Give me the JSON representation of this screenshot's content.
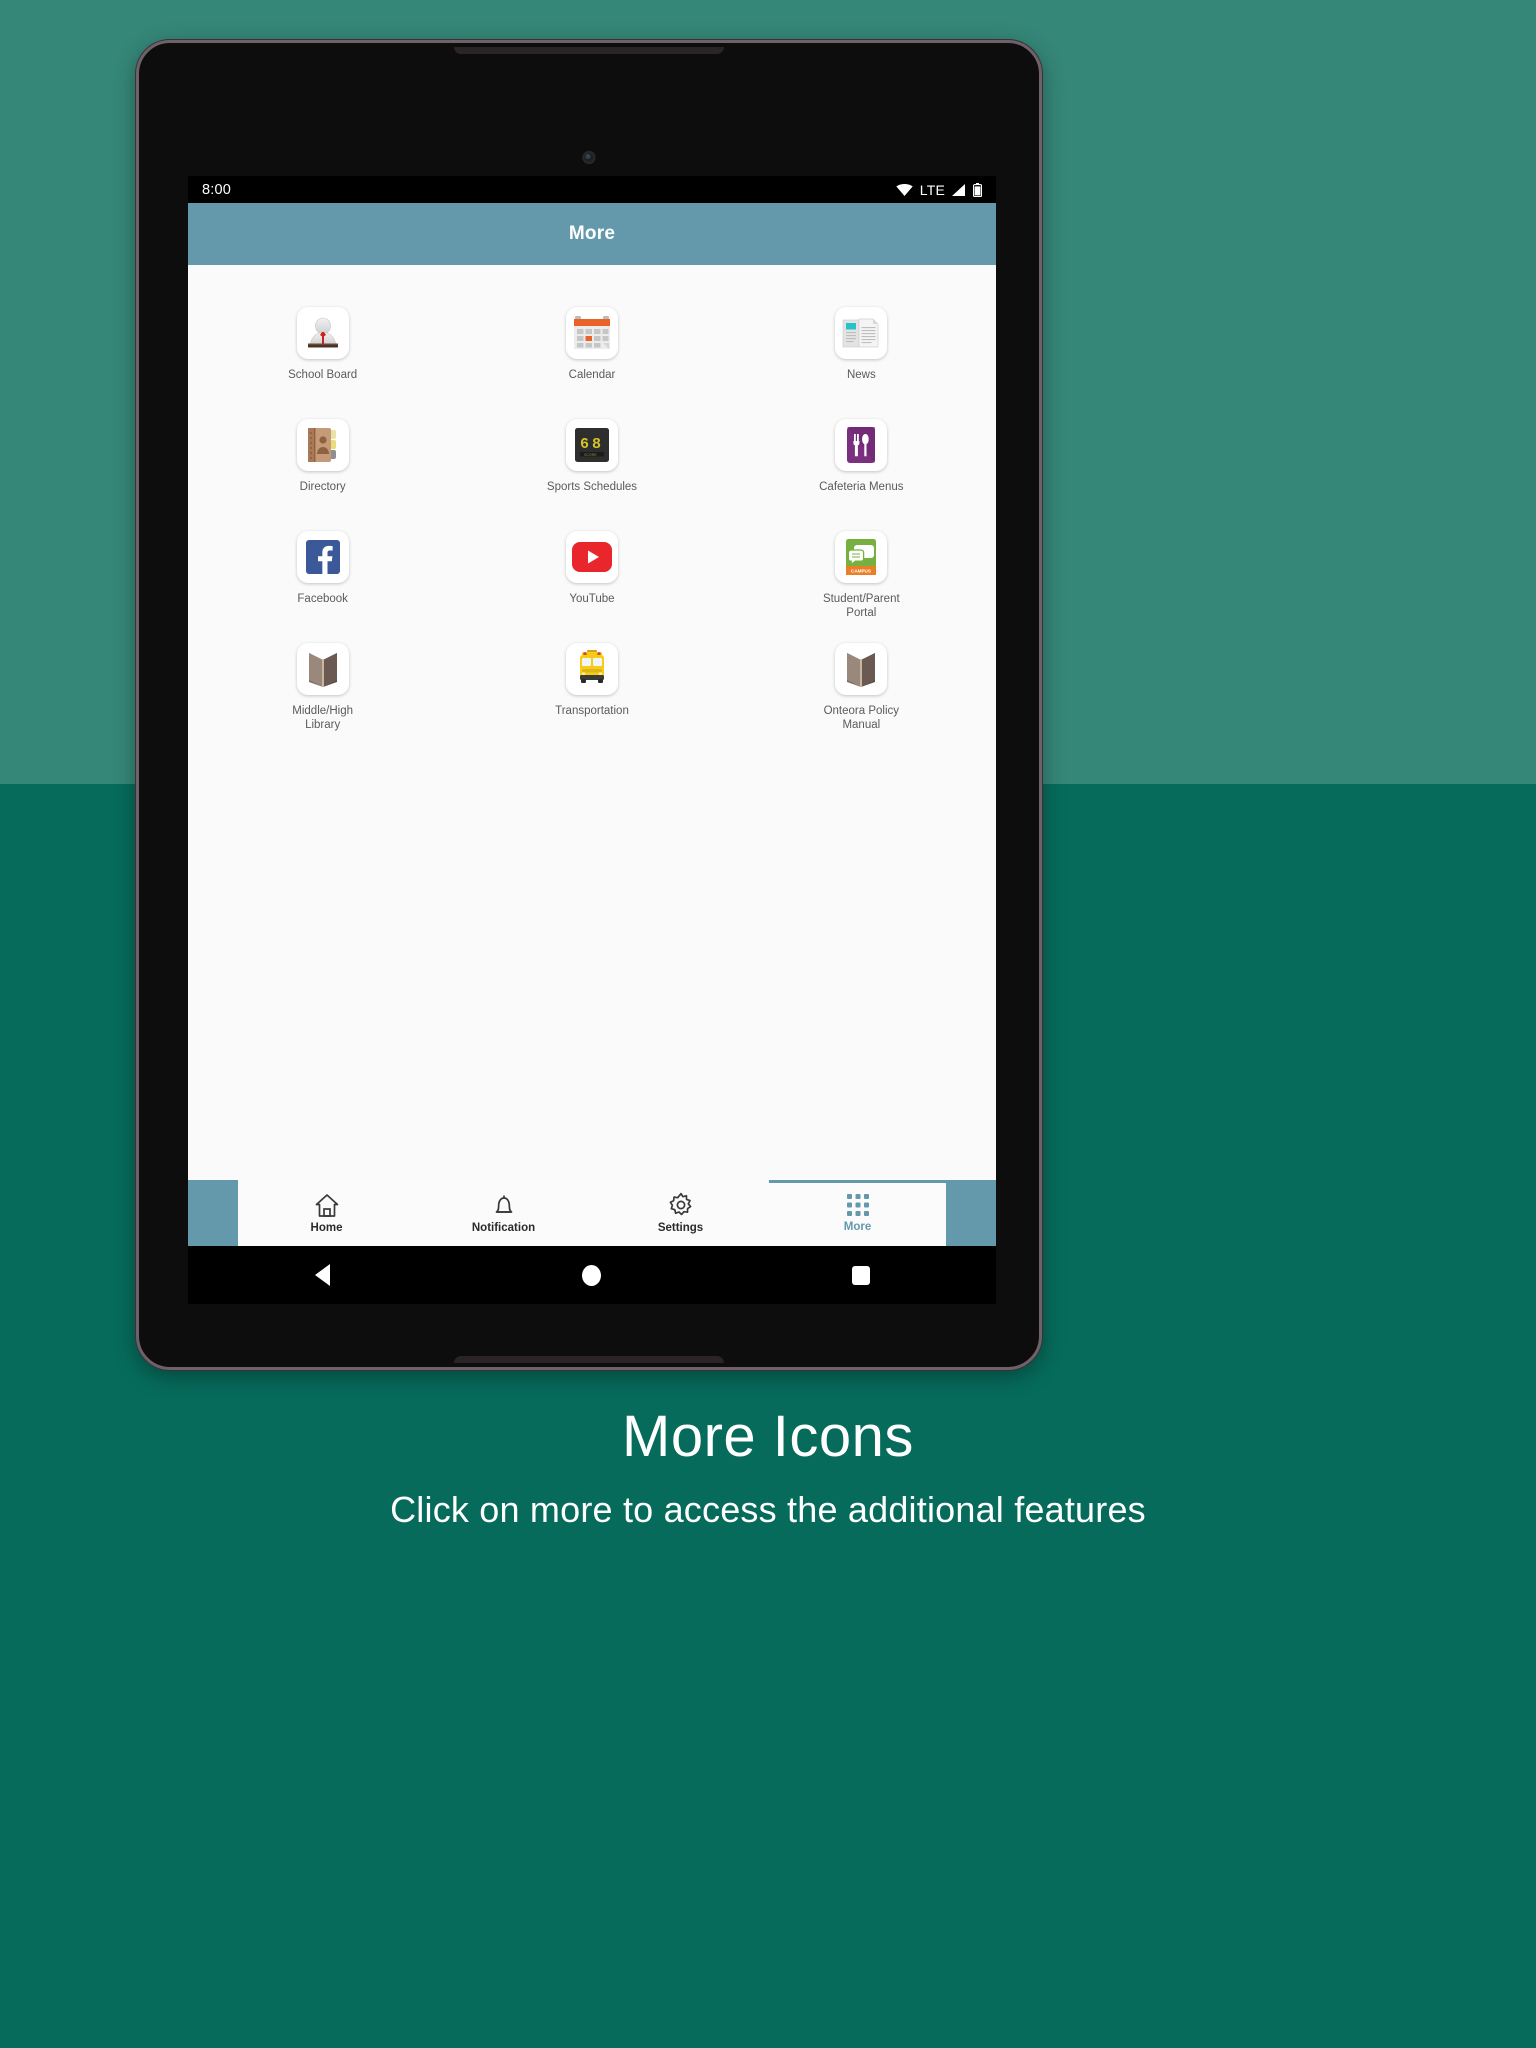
{
  "statusbar": {
    "time": "8:00",
    "network_label": "LTE",
    "icons": [
      "wifi-icon",
      "signal-icon",
      "battery-icon"
    ]
  },
  "appbar": {
    "title": "More"
  },
  "grid": {
    "rows": [
      [
        {
          "label": "School Board",
          "icon": "school-board-icon"
        },
        {
          "label": "Calendar",
          "icon": "calendar-icon"
        },
        {
          "label": "News",
          "icon": "news-icon"
        }
      ],
      [
        {
          "label": "Directory",
          "icon": "directory-icon"
        },
        {
          "label": "Sports Schedules",
          "icon": "scoreboard-icon",
          "score": "68",
          "score_caption": "SCORE"
        },
        {
          "label": "Cafeteria Menus",
          "icon": "cutlery-icon"
        }
      ],
      [
        {
          "label": "Facebook",
          "icon": "facebook-icon"
        },
        {
          "label": "YouTube",
          "icon": "youtube-icon"
        },
        {
          "label": "Student/Parent Portal",
          "icon": "campus-portal-icon",
          "badge": "CAMPUS"
        }
      ],
      [
        {
          "label": "Middle/High Library",
          "icon": "open-book-icon"
        },
        {
          "label": "Transportation",
          "icon": "school-bus-icon"
        },
        {
          "label": "Onteora Policy Manual",
          "icon": "open-book-icon"
        }
      ]
    ]
  },
  "tabbar": {
    "items": [
      {
        "label": "Home",
        "icon": "home-icon",
        "active": false
      },
      {
        "label": "Notification",
        "icon": "bell-icon",
        "active": false
      },
      {
        "label": "Settings",
        "icon": "gear-icon",
        "active": false
      },
      {
        "label": "More",
        "icon": "grid-icon",
        "active": true
      }
    ]
  },
  "androidnav": {
    "back": "back-triangle-icon",
    "home": "home-circle-icon",
    "recents": "recents-square-icon"
  },
  "caption": {
    "title": "More Icons",
    "subtitle": "Click on more to access the additional features"
  },
  "colors": {
    "accent": "#6499ac",
    "bg_top": "#358778",
    "bg_bottom": "#066b5b",
    "screen_bg": "#fafafa",
    "news_accent": "#25c2c6",
    "cafeteria": "#7b2f7f",
    "facebook": "#3b5998",
    "youtube": "#e8262b",
    "campus_green": "#76b041",
    "campus_orange": "#ea7f2a",
    "bus_yellow": "#f5cc18"
  }
}
